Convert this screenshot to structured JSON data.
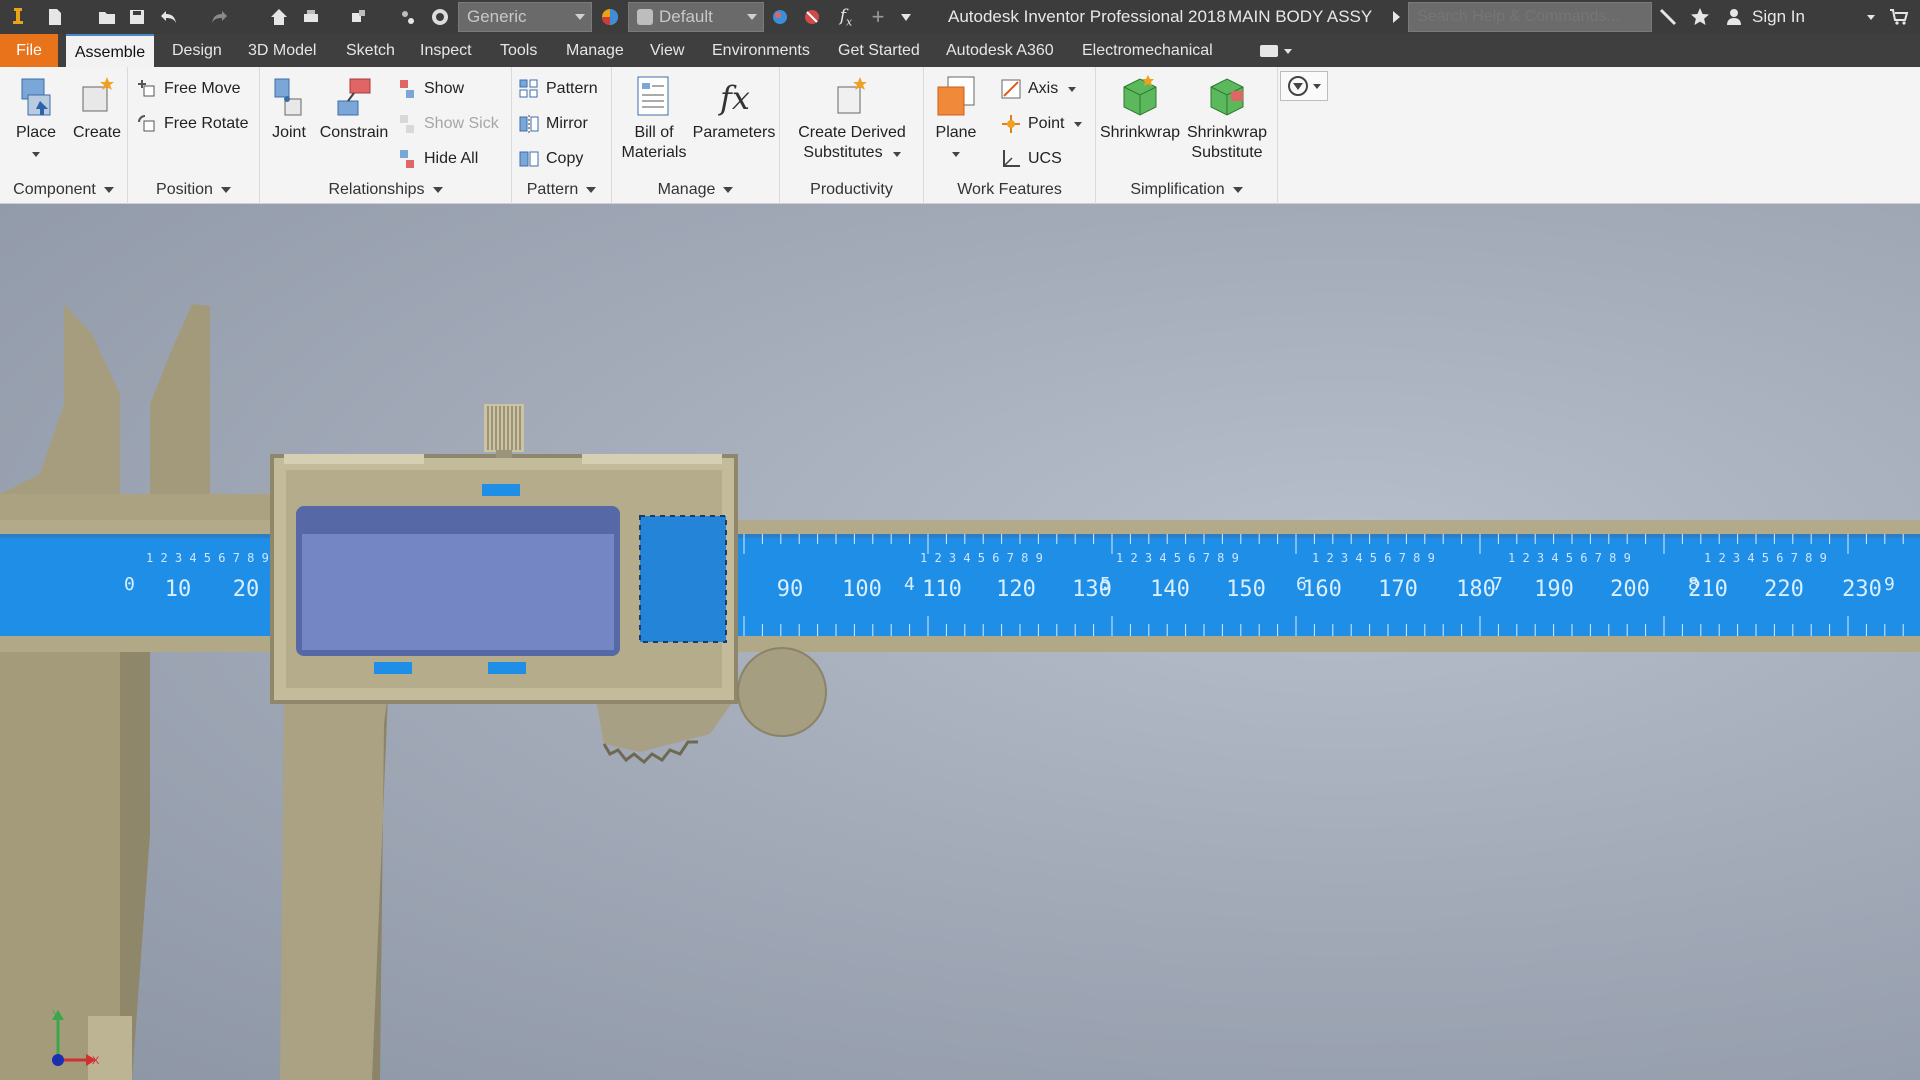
{
  "titlebar": {
    "style_combo": "Generic",
    "appearance_combo": "Default",
    "app_title": "Autodesk Inventor Professional 2018",
    "document_title": "MAIN BODY ASSY",
    "search_placeholder": "Search Help & Commands...",
    "sign_in": "Sign In"
  },
  "tabs": [
    "File",
    "Assemble",
    "Design",
    "3D Model",
    "Sketch",
    "Inspect",
    "Tools",
    "Manage",
    "View",
    "Environments",
    "Get Started",
    "Autodesk A360",
    "Electromechanical"
  ],
  "active_tab": "Assemble",
  "ribbon": {
    "component": {
      "title": "Component",
      "place": "Place",
      "create": "Create"
    },
    "position": {
      "title": "Position",
      "free_move": "Free Move",
      "free_rotate": "Free Rotate"
    },
    "relationships": {
      "title": "Relationships",
      "joint": "Joint",
      "constrain": "Constrain",
      "show": "Show",
      "show_sick": "Show Sick",
      "hide_all": "Hide All"
    },
    "pattern": {
      "title": "Pattern",
      "pattern": "Pattern",
      "mirror": "Mirror",
      "copy": "Copy"
    },
    "manage": {
      "title": "Manage",
      "bom_line1": "Bill of",
      "bom_line2": "Materials",
      "parameters": "Parameters"
    },
    "productivity": {
      "title": "Productivity",
      "line1": "Create Derived",
      "line2": "Substitutes"
    },
    "work_features": {
      "title": "Work Features",
      "plane": "Plane",
      "axis": "Axis",
      "point": "Point",
      "ucs": "UCS"
    },
    "simplification": {
      "title": "Simplification",
      "shrinkwrap": "Shrinkwrap",
      "sws_line1": "Shrinkwrap",
      "sws_line2": "Substitute"
    }
  },
  "scale": {
    "main_labels": [
      "10",
      "20",
      "90",
      "100",
      "110",
      "120",
      "130",
      "140",
      "150",
      "160",
      "170",
      "180",
      "190",
      "200",
      "210",
      "220",
      "230"
    ],
    "major_digits": [
      "0",
      "4",
      "5",
      "6",
      "7",
      "8",
      "9"
    ],
    "minor_run": "1 2 3 4 5 6 7 8 9"
  },
  "triad": {
    "x_label": "X",
    "y_label": "Y"
  },
  "colors": {
    "file_tab": "#e8731a",
    "scale_blue": "#1f8ee6",
    "body": "#b9b090",
    "background": "#9ea7b6"
  }
}
